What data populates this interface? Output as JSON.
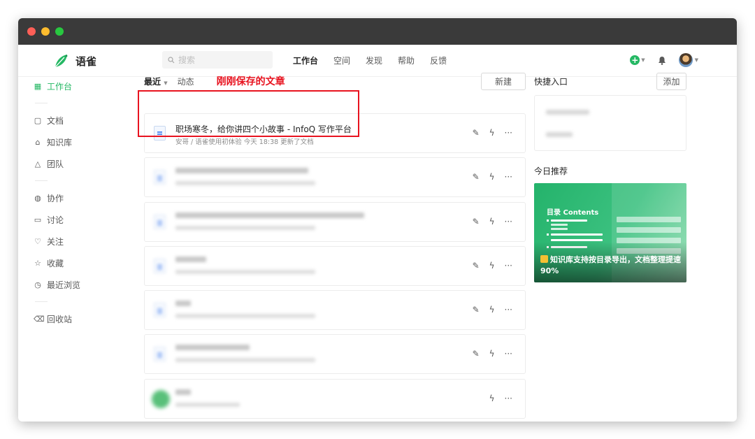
{
  "app": {
    "name": "语雀"
  },
  "search": {
    "placeholder": "搜索"
  },
  "nav": {
    "links": [
      "工作台",
      "空间",
      "发现",
      "帮助",
      "反馈"
    ],
    "active": "工作台"
  },
  "sidebar": {
    "items": [
      {
        "icon": "grid-icon",
        "label": "工作台",
        "active": true
      },
      {
        "icon": "document-icon",
        "label": "文档"
      },
      {
        "icon": "library-icon",
        "label": "知识库"
      },
      {
        "icon": "team-icon",
        "label": "团队"
      },
      {
        "icon": "globe-icon",
        "label": "协作"
      },
      {
        "icon": "comment-icon",
        "label": "讨论"
      },
      {
        "icon": "heart-icon",
        "label": "关注"
      },
      {
        "icon": "star-icon",
        "label": "收藏"
      },
      {
        "icon": "clock-icon",
        "label": "最近浏览"
      },
      {
        "icon": "trash-icon",
        "label": "回收站"
      }
    ]
  },
  "main": {
    "tab_recent": "最近",
    "tab_activity": "动态",
    "annotation": "刚刚保存的文章",
    "new_button": "新建",
    "docs": [
      {
        "title": "职场寒冬，给你讲四个小故事 - InfoQ 写作平台",
        "meta": "安哥 / 语雀使用初体验   今天 18:38 更新了文档",
        "blurred": false
      }
    ]
  },
  "quick": {
    "title": "快捷入口",
    "add_button": "添加"
  },
  "recommend": {
    "title": "今日推荐",
    "card_heading": "目录 Contents",
    "card_caption": "知识库支持按目录导出，文档整理提速90%"
  },
  "colors": {
    "brand_green": "#25b864",
    "annotation_red": "#e8131f"
  }
}
